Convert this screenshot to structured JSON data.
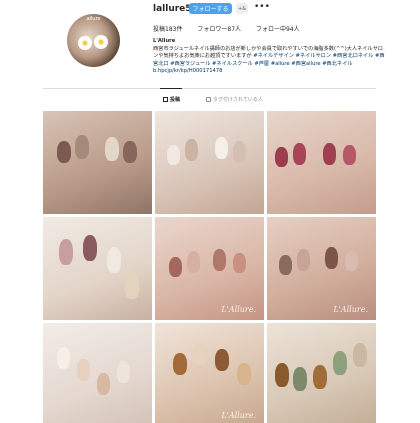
{
  "profile": {
    "username": "lallure5",
    "follow_label": "フォローする",
    "suggest_label": "+&",
    "more_icon": "more-horizontal-icon",
    "avatar_text": "allure",
    "stats": {
      "posts": "投稿183件",
      "followers": "フォロワー87人",
      "following": "フォロー中94人"
    },
    "bio": {
      "name": "L'Allure",
      "text": "西宮市ラジュールネイル講師のお店が新しかや会員で取れやすいでの海脂多数(^^)大人ネイルサロンや気持ちよお気楽にお越頂ですいますが",
      "tags": "#ネイルデザイン #ネイルサロン #西宮北口ネイル #西宮北口 #西宮ラジュール #ネイルスクール #芦屋 #allure #西宮allure #西北ネイル",
      "link": "b.hpcjp/kr/kp/H000171478"
    }
  },
  "tabs": {
    "posts_label": "投稿",
    "tagged_label": "タグ付けされている人",
    "posts_icon": "grid-icon",
    "tagged_icon": "tag-icon"
  },
  "grid": {
    "watermark": "L'Allure.",
    "tiles": [
      {
        "id": "post-1"
      },
      {
        "id": "post-2"
      },
      {
        "id": "post-3"
      },
      {
        "id": "post-4"
      },
      {
        "id": "post-5"
      },
      {
        "id": "post-6"
      },
      {
        "id": "post-7"
      },
      {
        "id": "post-8"
      },
      {
        "id": "post-9"
      }
    ]
  },
  "colors": {
    "accent": "#4aa3f0",
    "text": "#262626",
    "muted": "#8e8e8e",
    "link": "#00376b"
  }
}
